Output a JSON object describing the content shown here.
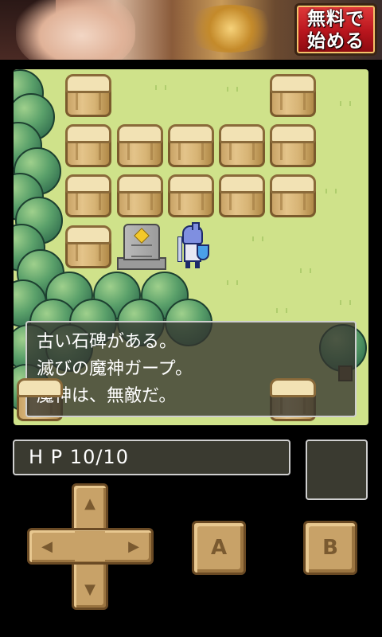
{
  "ad_banner": {
    "button_line1": "無料で",
    "button_line2": "始める",
    "accent_color": "#c8151d"
  },
  "message_window": {
    "lines": [
      "古い石碑がある。",
      "滅びの魔神ガープ。",
      "魔神は、無敵だ。"
    ]
  },
  "status": {
    "hp_label": "H P",
    "hp_value": "10/10"
  },
  "controls": {
    "dpad_up": "▲",
    "dpad_down": "▼",
    "dpad_left": "◀",
    "dpad_right": "▶",
    "a_label": "A",
    "b_label": "B"
  },
  "map": {
    "player_sprite": "knight-icon",
    "object_sprite": "stone-tablet-icon",
    "grass_color": "#cfe28a"
  }
}
